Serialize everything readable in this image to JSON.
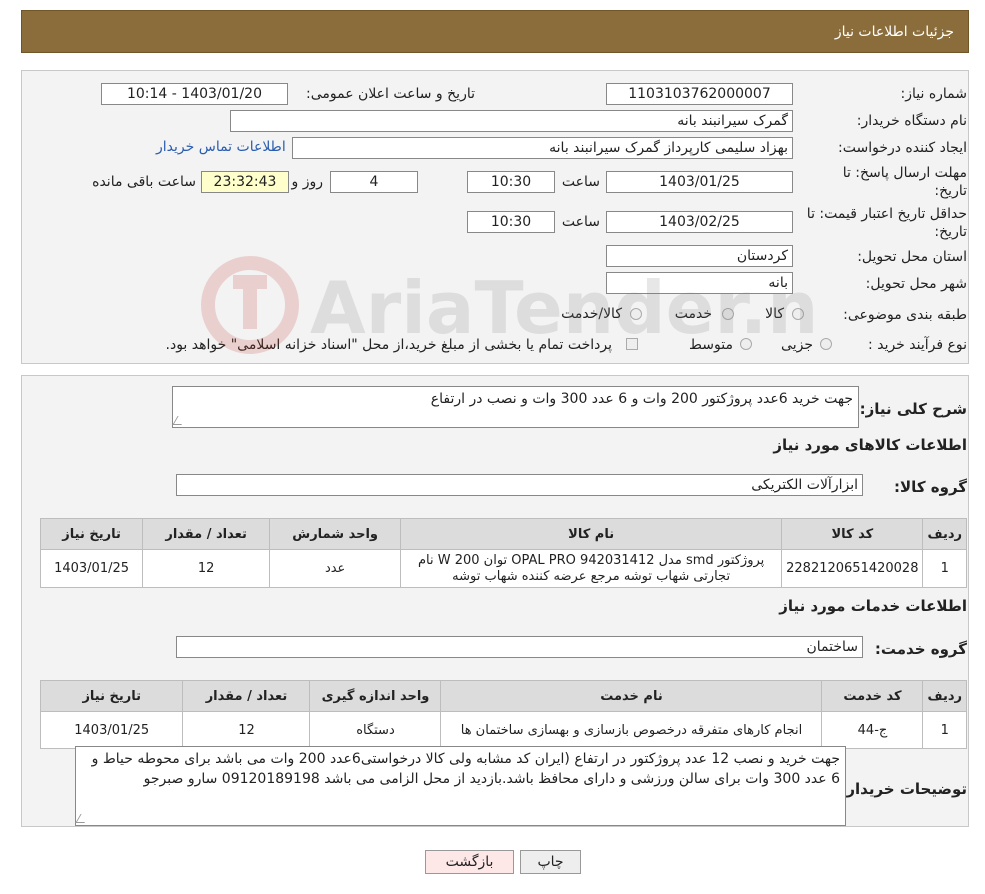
{
  "header": {
    "title": "جزئیات اطلاعات نیاز"
  },
  "form": {
    "need_number_label": "شماره نیاز:",
    "need_number": "1103103762000007",
    "announce_label": "تاریخ و ساعت اعلان عمومی:",
    "announce_value": "1403/01/20 - 10:14",
    "buyer_org_label": "نام دستگاه خریدار:",
    "buyer_org": "گمرک سیرانبند بانه",
    "creator_label": "ایجاد کننده درخواست:",
    "creator": "بهزاد سلیمی کارپرداز گمرک سیرانبند بانه",
    "contact_link": "اطلاعات تماس خریدار",
    "reply_deadline_label_1": "مهلت ارسال پاسخ: تا",
    "reply_deadline_label_2": "تاریخ:",
    "reply_date": "1403/01/25",
    "time_label": "ساعت",
    "reply_time": "10:30",
    "days": "4",
    "days_label": "روز و",
    "remaining": "23:32:43",
    "remaining_label": "ساعت باقی مانده",
    "price_valid_label_1": "حداقل تاریخ اعتبار قیمت: تا",
    "price_valid_label_2": "تاریخ:",
    "price_valid_date": "1403/02/25",
    "price_valid_time": "10:30",
    "province_label": "استان محل تحویل:",
    "province": "کردستان",
    "city_label": "شهر محل تحویل:",
    "city": "بانه",
    "category_label": "طبقه بندی موضوعی:",
    "category_options": [
      "کالا",
      "خدمت",
      "کالا/خدمت"
    ],
    "process_label": "نوع فرآیند خرید :",
    "process_options": [
      "جزیی",
      "متوسط"
    ],
    "payment_note": "پرداخت تمام یا بخشی از مبلغ خرید،از محل \"اسناد خزانه اسلامی\" خواهد بود."
  },
  "description": {
    "label": "شرح کلی نیاز:",
    "value": "جهت خرید 6عدد پروژکتور 200 وات و 6 عدد 300 وات  و نصب در ارتفاع"
  },
  "goods": {
    "heading": "اطلاعات کالاهای مورد نیاز",
    "group_label": "گروه کالا:",
    "group_value": "ابزارآلات الکتریکی",
    "columns": [
      "ردیف",
      "کد کالا",
      "نام کالا",
      "واحد شمارش",
      "تعداد / مقدار",
      "تاریخ نیاز"
    ],
    "rows": [
      [
        "1",
        "2282120651420028",
        "پروژکتور smd مدل OPAL PRO 942031412 توان W 200 نام تجارتی شهاب توشه مرجع عرضه کننده شهاب توشه",
        "عدد",
        "12",
        "1403/01/25"
      ]
    ]
  },
  "services": {
    "heading": "اطلاعات خدمات مورد نیاز",
    "group_label": "گروه خدمت:",
    "group_value": "ساختمان",
    "columns": [
      "ردیف",
      "کد خدمت",
      "نام خدمت",
      "واحد اندازه گیری",
      "تعداد / مقدار",
      "تاریخ نیاز"
    ],
    "rows": [
      [
        "1",
        "ج-44",
        "انجام کارهای متفرقه درخصوص بازسازی و بهسازی ساختمان ها",
        "دستگاه",
        "12",
        "1403/01/25"
      ]
    ]
  },
  "buyer_notes": {
    "label": "توضیحات خریدار:",
    "value": "جهت خرید و نصب 12 عدد پروژکتور  در ارتفاع (ایران کد مشابه ولی کالا درخواستی6عدد 200 وات می باشد برای محوطه حیاط و 6 عدد 300 وات  برای سالن ورزشی و دارای محافظ باشد.بازدید از محل الزامی می باشد 09120189198 سارو صبرجو"
  },
  "buttons": {
    "print": "چاپ",
    "back": "بازگشت"
  },
  "watermark": {
    "text": "AriaTender.neT"
  }
}
